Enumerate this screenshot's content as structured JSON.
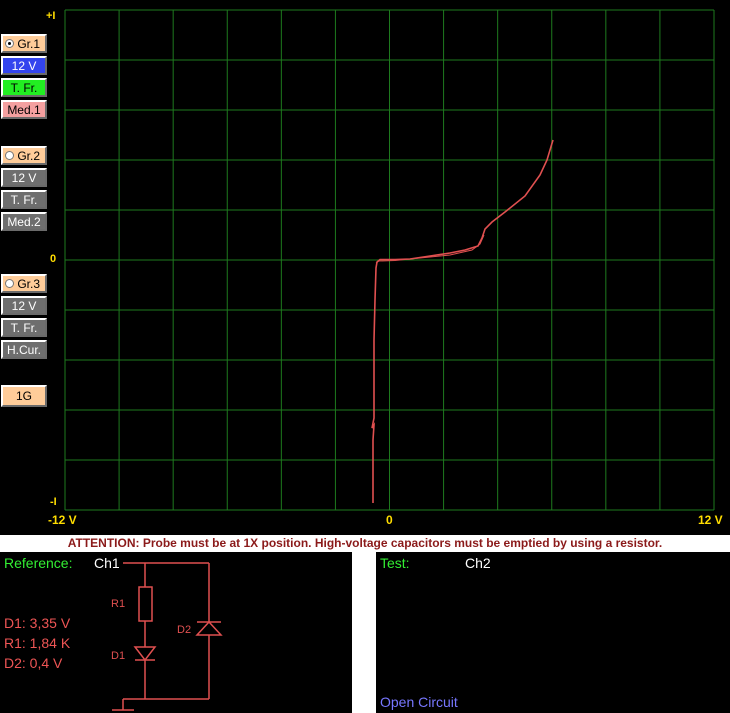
{
  "sidebar": {
    "gr1": {
      "label": "Gr.1",
      "selected": true,
      "voltage": "12 V",
      "freq": "T. Fr.",
      "med": "Med.1"
    },
    "gr2": {
      "label": "Gr.2",
      "selected": false,
      "voltage": "12 V",
      "freq": "T. Fr.",
      "med": "Med.2"
    },
    "gr3": {
      "label": "Gr.3",
      "selected": false,
      "voltage": "12 V",
      "freq": "T. Fr.",
      "med": "H.Cur."
    },
    "gen_button": "1G"
  },
  "scope": {
    "y_top_label": "+I",
    "y_zero_label": "0",
    "y_bottom_label": "-I",
    "x_left_label": "-12 V",
    "x_zero_label": "0",
    "x_right_label": "12 V",
    "grid_color": "#1e7a1e",
    "trace_color": "#e05050"
  },
  "attention": "ATTENTION: Probe must be at 1X position. High-voltage capacitors must be emptied by using a resistor.",
  "reference": {
    "title": "Reference:",
    "channel": "Ch1",
    "components": [
      "D1: 3,35 V",
      "R1: 1,84 K",
      "D2: 0,4 V"
    ],
    "schematic_labels": {
      "r1": "R1",
      "d1": "D1",
      "d2": "D2"
    }
  },
  "test": {
    "title": "Test:",
    "channel": "Ch2",
    "status": "Open Circuit"
  }
}
